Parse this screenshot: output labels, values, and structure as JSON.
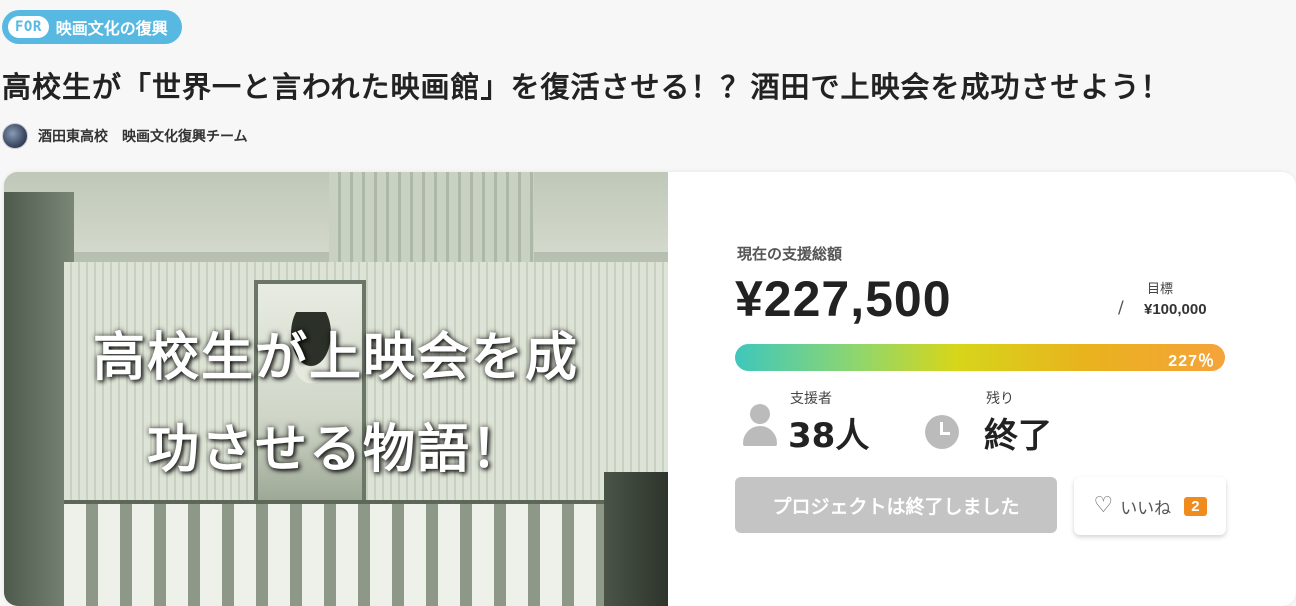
{
  "tag": {
    "prefix": "FOR",
    "label": "映画文化の復興"
  },
  "project": {
    "title": "高校生が「世界一と言われた映画館」を復活させる！？酒田で上映会を成功させよう！",
    "owner": "酒田東高校　映画文化復興チーム"
  },
  "hero": {
    "overlay_line1": "高校生が上映会を成",
    "overlay_line2": "功させる物語！"
  },
  "stats": {
    "raised_label": "現在の支援総額",
    "raised_amount": "¥227,500",
    "goal_slash": "/",
    "goal_label": "目標",
    "goal_amount": "¥100,000",
    "progress_percent_text": "227％",
    "progress_fraction": 2.275,
    "supporters_label": "支援者",
    "supporters_value": "38人",
    "remaining_label": "残り",
    "remaining_value": "終了"
  },
  "actions": {
    "ended_label": "プロジェクトは終了しました",
    "like_label": "いいね",
    "like_count": "2"
  },
  "colors": {
    "tag_blue": "#57b9e2",
    "like_badge": "#f08c1e",
    "ended_button": "#c4c4c4"
  },
  "icons": [
    "person-icon",
    "clock-icon",
    "heart-icon",
    "avatar"
  ]
}
